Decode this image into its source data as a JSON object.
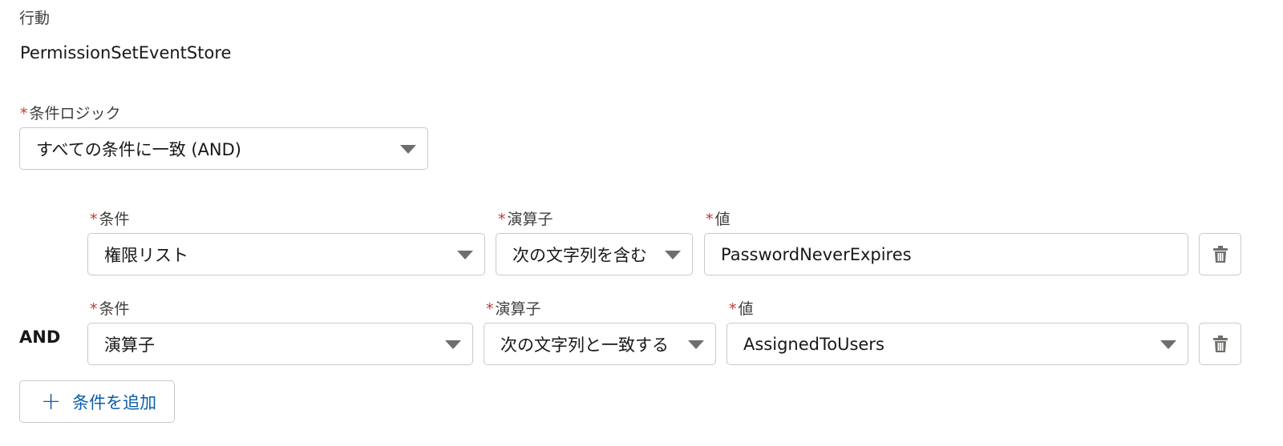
{
  "action": {
    "label": "行動",
    "value": "PermissionSetEventStore"
  },
  "condition_logic": {
    "label": "条件ロジック",
    "required_mark": "*",
    "selected": "すべての条件に一致 (AND)"
  },
  "conditions": [
    {
      "connector": "",
      "field_label": "条件",
      "field_value": "権限リスト",
      "operator_label": "演算子",
      "operator_value": "次の文字列を含む",
      "value_label": "値",
      "value": "PasswordNeverExpires"
    },
    {
      "connector": "AND",
      "field_label": "条件",
      "field_value": "演算子",
      "operator_label": "演算子",
      "operator_value": "次の文字列と一致する",
      "value_label": "値",
      "value": "AssignedToUsers"
    }
  ],
  "add_condition": {
    "label": "条件を追加",
    "icon": "plus-icon"
  },
  "colors": {
    "required": "#c23934",
    "link": "#0b5cab",
    "border": "#c9c9c9"
  }
}
